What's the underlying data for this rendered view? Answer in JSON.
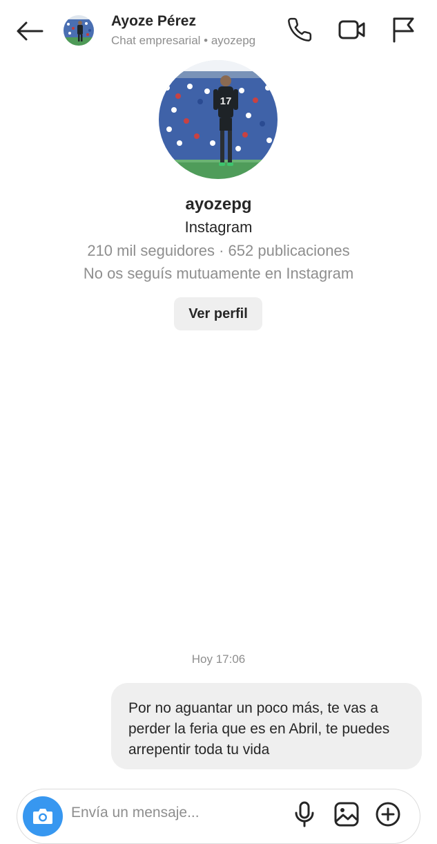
{
  "header": {
    "name": "Ayoze Pérez",
    "subtitle": "Chat empresarial • ayozepg",
    "icons": [
      "back-arrow-icon",
      "phone-icon",
      "video-camera-icon",
      "flag-icon"
    ]
  },
  "profile": {
    "username": "ayozepg",
    "platform": "Instagram",
    "stats": "210 mil seguidores · 652 publicaciones",
    "mutual": "No os seguís mutuamente en Instagram",
    "view_profile_label": "Ver perfil",
    "jersey_number": "17"
  },
  "messages": {
    "timestamp": "Hoy 17:06",
    "items": [
      {
        "sender": "me",
        "text": "Por no aguantar un poco más, te vas a perder la feria que es en Abril, te puedes arrepentir toda tu vida"
      }
    ]
  },
  "composer": {
    "placeholder": "Envía un mensaje...",
    "icons": [
      "camera-icon",
      "microphone-icon",
      "gallery-icon",
      "plus-circle-icon"
    ]
  },
  "colors": {
    "accent": "#3797f0",
    "text": "#262626",
    "secondary_text": "#8e8e8e",
    "bubble": "#efefef",
    "border": "#dbdbdb"
  }
}
